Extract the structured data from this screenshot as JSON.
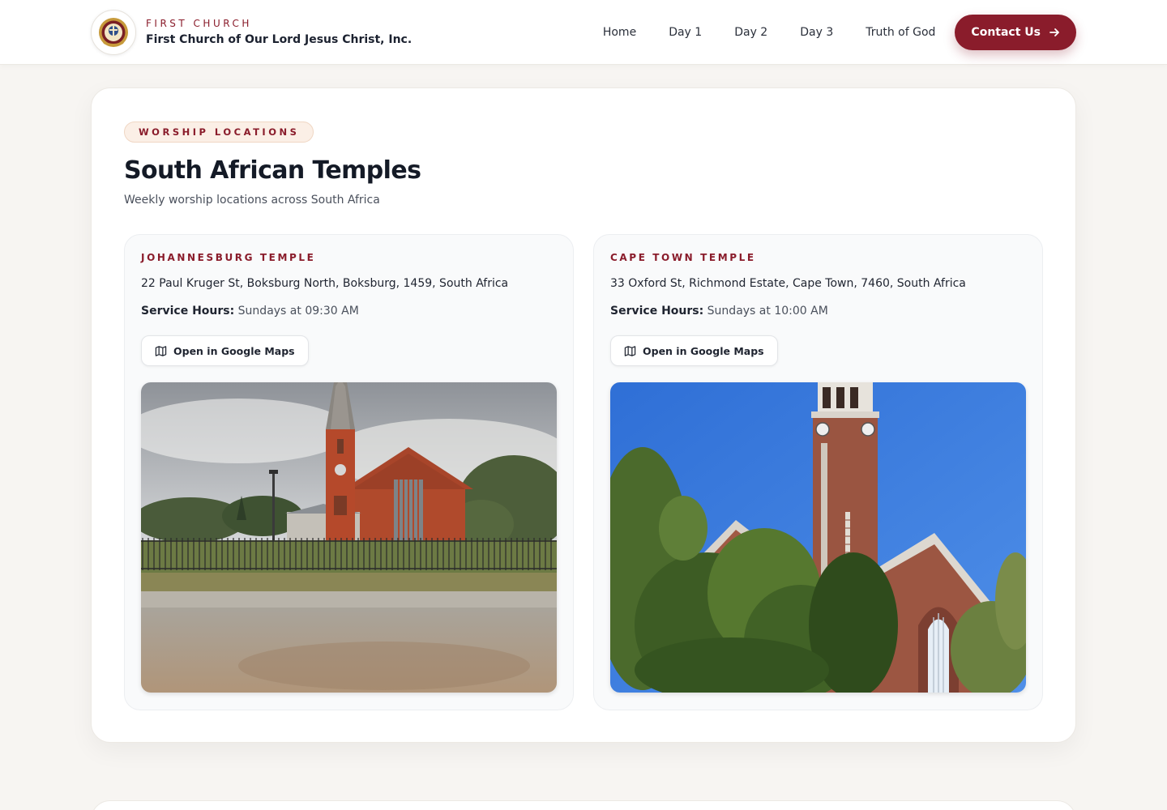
{
  "brand": {
    "eyebrow": "FIRST CHURCH",
    "name": "First Church of Our Lord Jesus Christ, Inc.",
    "logo_icon": "church-seal-icon"
  },
  "nav": {
    "items": [
      {
        "label": "Home"
      },
      {
        "label": "Day 1"
      },
      {
        "label": "Day 2"
      },
      {
        "label": "Day 3"
      },
      {
        "label": "Truth of God"
      }
    ],
    "contact_label": "Contact Us",
    "contact_icon": "arrow-right-icon"
  },
  "section": {
    "eyebrow": "WORSHIP LOCATIONS",
    "title": "South African Temples",
    "subtitle": "Weekly worship locations across South Africa"
  },
  "temples": [
    {
      "name": "JOHANNESBURG TEMPLE",
      "address": "22 Paul Kruger St, Boksburg North, Boksburg, 1459, South Africa",
      "hours_label": "Service Hours:",
      "hours_value": "Sundays at 09:30 AM",
      "maps_label": "Open in Google Maps",
      "maps_icon": "map-icon"
    },
    {
      "name": "CAPE TOWN TEMPLE",
      "address": "33 Oxford St, Richmond Estate, Cape Town, 7460, South Africa",
      "hours_label": "Service Hours:",
      "hours_value": "Sundays at 10:00 AM",
      "maps_label": "Open in Google Maps",
      "maps_icon": "map-icon"
    }
  ],
  "colors": {
    "accent": "#8a1c2b",
    "background": "#f7f5f2",
    "card": "#ffffff",
    "pill_bg": "#fbefe6"
  }
}
